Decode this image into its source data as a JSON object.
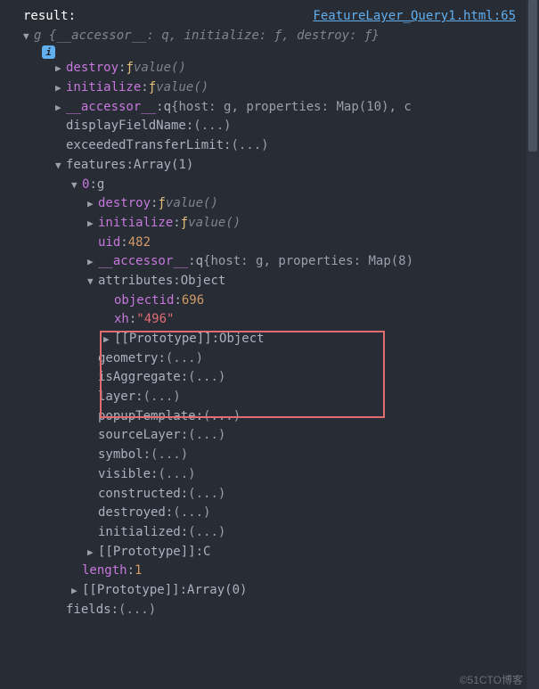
{
  "header": {
    "label": "result:",
    "source_link": "FeatureLayer_Query1.html:65"
  },
  "root_summary": {
    "prefix": "g {",
    "accessor_k": "__accessor__",
    "accessor_v": "q",
    "init_k": "initialize",
    "init_v": "ƒ",
    "destroy_k": "destroy",
    "destroy_v": "ƒ",
    "suffix": "}"
  },
  "info_badge": "i",
  "tree": {
    "destroy": {
      "key": "destroy",
      "type": "ƒ",
      "val": "value()"
    },
    "initialize": {
      "key": "initialize",
      "type": "ƒ",
      "val": "value()"
    },
    "accessor": {
      "key": "__accessor__",
      "type": "q",
      "val": "{host: g, properties: Map(10), c"
    },
    "displayFieldName": {
      "key": "displayFieldName",
      "val": "(...)"
    },
    "exceededTransferLimit": {
      "key": "exceededTransferLimit",
      "val": "(...)"
    },
    "features": {
      "key": "features",
      "val": "Array(1)"
    },
    "f0": {
      "key": "0",
      "val": "g"
    },
    "f0_destroy": {
      "key": "destroy",
      "type": "ƒ",
      "val": "value()"
    },
    "f0_initialize": {
      "key": "initialize",
      "type": "ƒ",
      "val": "value()"
    },
    "f0_uid": {
      "key": "uid",
      "num": "482"
    },
    "f0_accessor": {
      "key": "__accessor__",
      "type": "q",
      "val": "{host: g, properties: Map(8)"
    },
    "f0_attributes": {
      "key": "attributes",
      "val": "Object"
    },
    "attr_objectid": {
      "key": "objectid",
      "num": "696"
    },
    "attr_xh": {
      "key": "xh",
      "str": "\"496\""
    },
    "attr_proto": {
      "key": "[[Prototype]]",
      "val": "Object"
    },
    "f0_geometry": {
      "key": "geometry",
      "val": "(...)"
    },
    "f0_isAggregate": {
      "key": "isAggregate",
      "val": "(...)"
    },
    "f0_layer": {
      "key": "layer",
      "val": "(...)"
    },
    "f0_popupTemplate": {
      "key": "popupTemplate",
      "val": "(...)"
    },
    "f0_sourceLayer": {
      "key": "sourceLayer",
      "val": "(...)"
    },
    "f0_symbol": {
      "key": "symbol",
      "val": "(...)"
    },
    "f0_visible": {
      "key": "visible",
      "val": "(...)"
    },
    "f0_constructed": {
      "key": "constructed",
      "val": "(...)"
    },
    "f0_destroyed": {
      "key": "destroyed",
      "val": "(...)"
    },
    "f0_initialized": {
      "key": "initialized",
      "val": "(...)"
    },
    "f0_proto": {
      "key": "[[Prototype]]",
      "val": "C"
    },
    "features_length": {
      "key": "length",
      "num": "1"
    },
    "features_proto": {
      "key": "[[Prototype]]",
      "val": "Array(0)"
    },
    "fields": {
      "key": "fields",
      "val": "(...)"
    }
  },
  "watermark": "©51CTO博客"
}
